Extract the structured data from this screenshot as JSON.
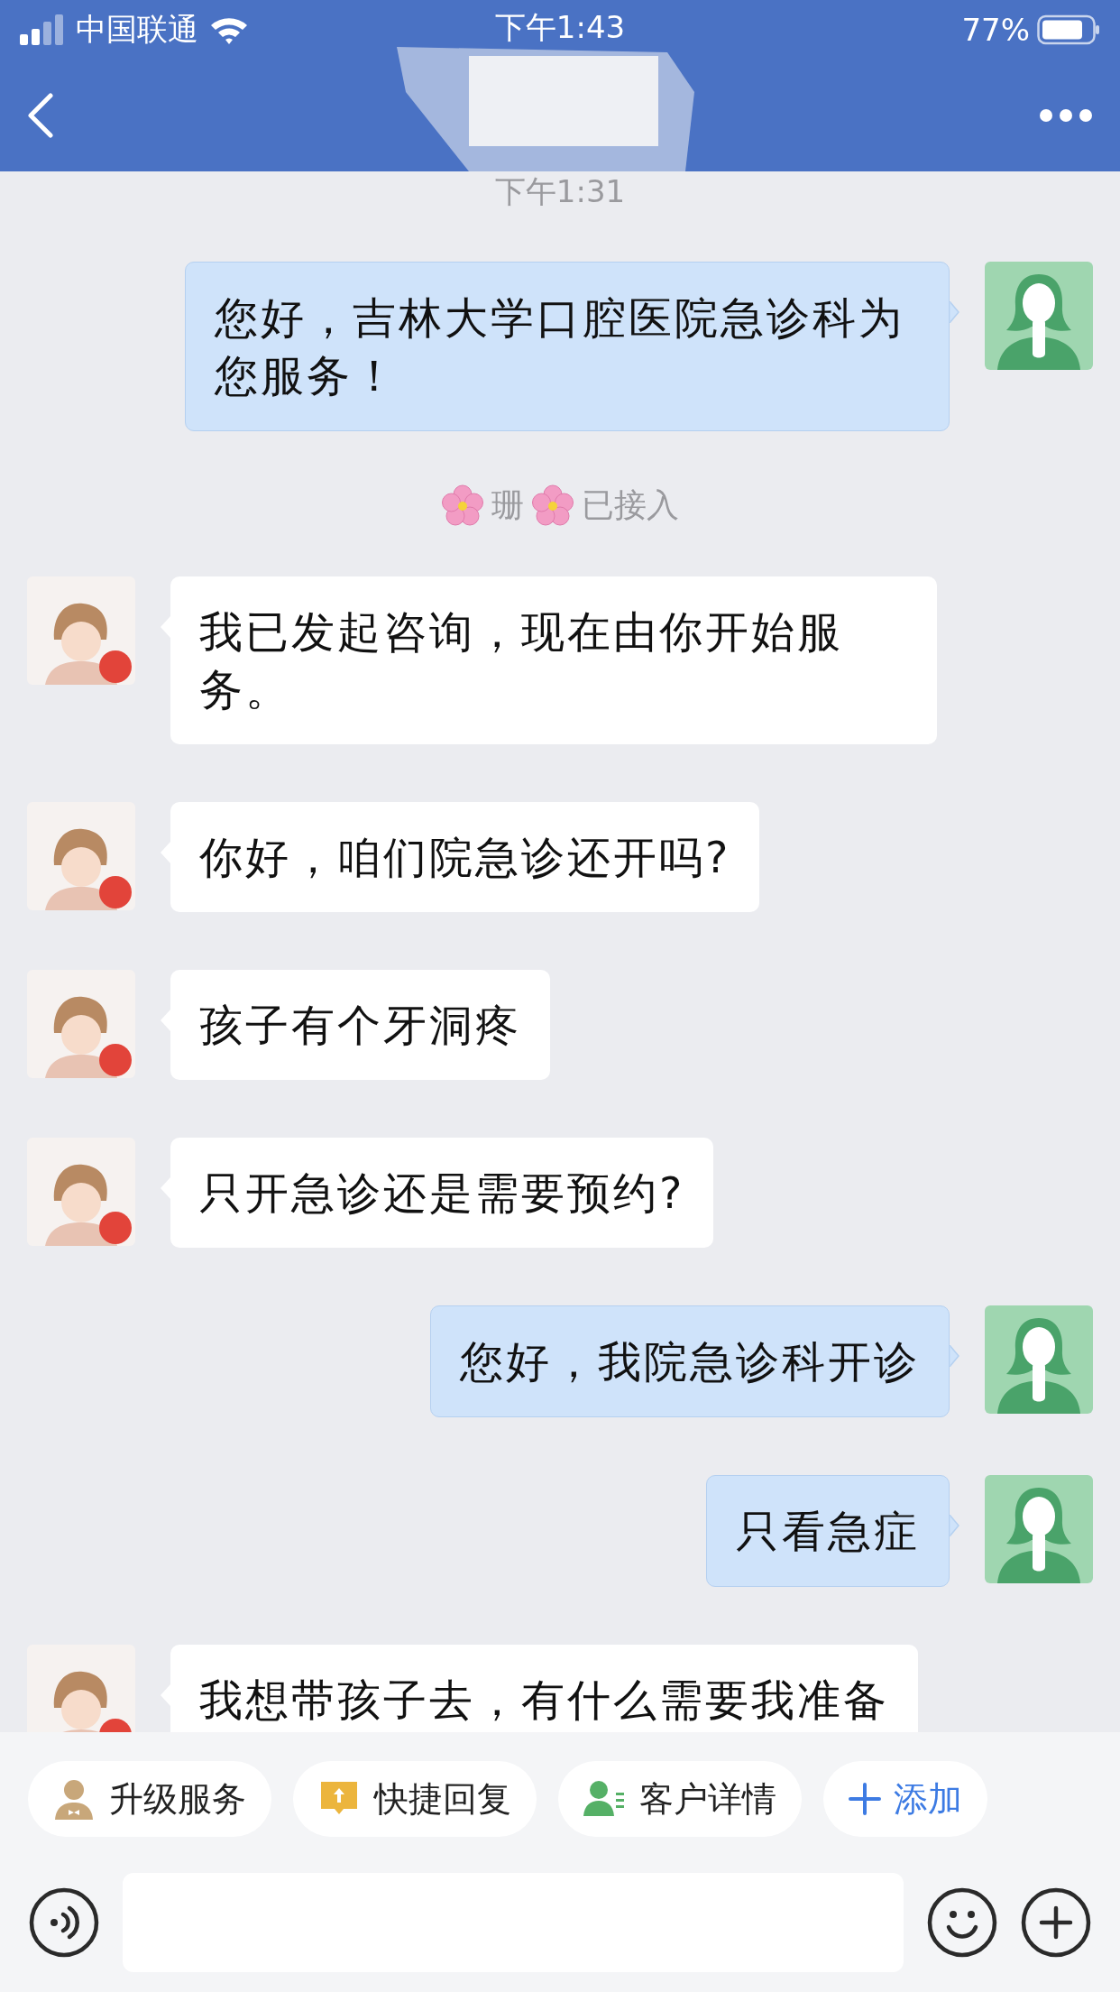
{
  "status_bar": {
    "carrier": "中国联通",
    "time": "下午1:43",
    "battery": "77%"
  },
  "messages": [
    {
      "kind": "time",
      "text": "下午1:31"
    },
    {
      "kind": "outgoing",
      "text": "您好，吉林大学口腔医院急诊科为您服务！"
    },
    {
      "kind": "system",
      "name": "珊",
      "text": "已接入"
    },
    {
      "kind": "incoming",
      "text": "我已发起咨询，现在由你开始服务。"
    },
    {
      "kind": "incoming",
      "text": "你好，咱们院急诊还开吗?"
    },
    {
      "kind": "incoming",
      "text": "孩子有个牙洞疼"
    },
    {
      "kind": "incoming",
      "text": "只开急诊还是需要预约?"
    },
    {
      "kind": "outgoing",
      "text": "您好，我院急诊科开诊"
    },
    {
      "kind": "outgoing",
      "text": "只看急症"
    },
    {
      "kind": "incoming",
      "text": "我想带孩子去，有什么需要我准备"
    }
  ],
  "quick_actions": [
    {
      "kind": "upgrade",
      "label": "升级服务"
    },
    {
      "kind": "quick_reply",
      "label": "快捷回复"
    },
    {
      "kind": "customer",
      "label": "客户详情"
    },
    {
      "kind": "add",
      "label": "添加"
    }
  ]
}
